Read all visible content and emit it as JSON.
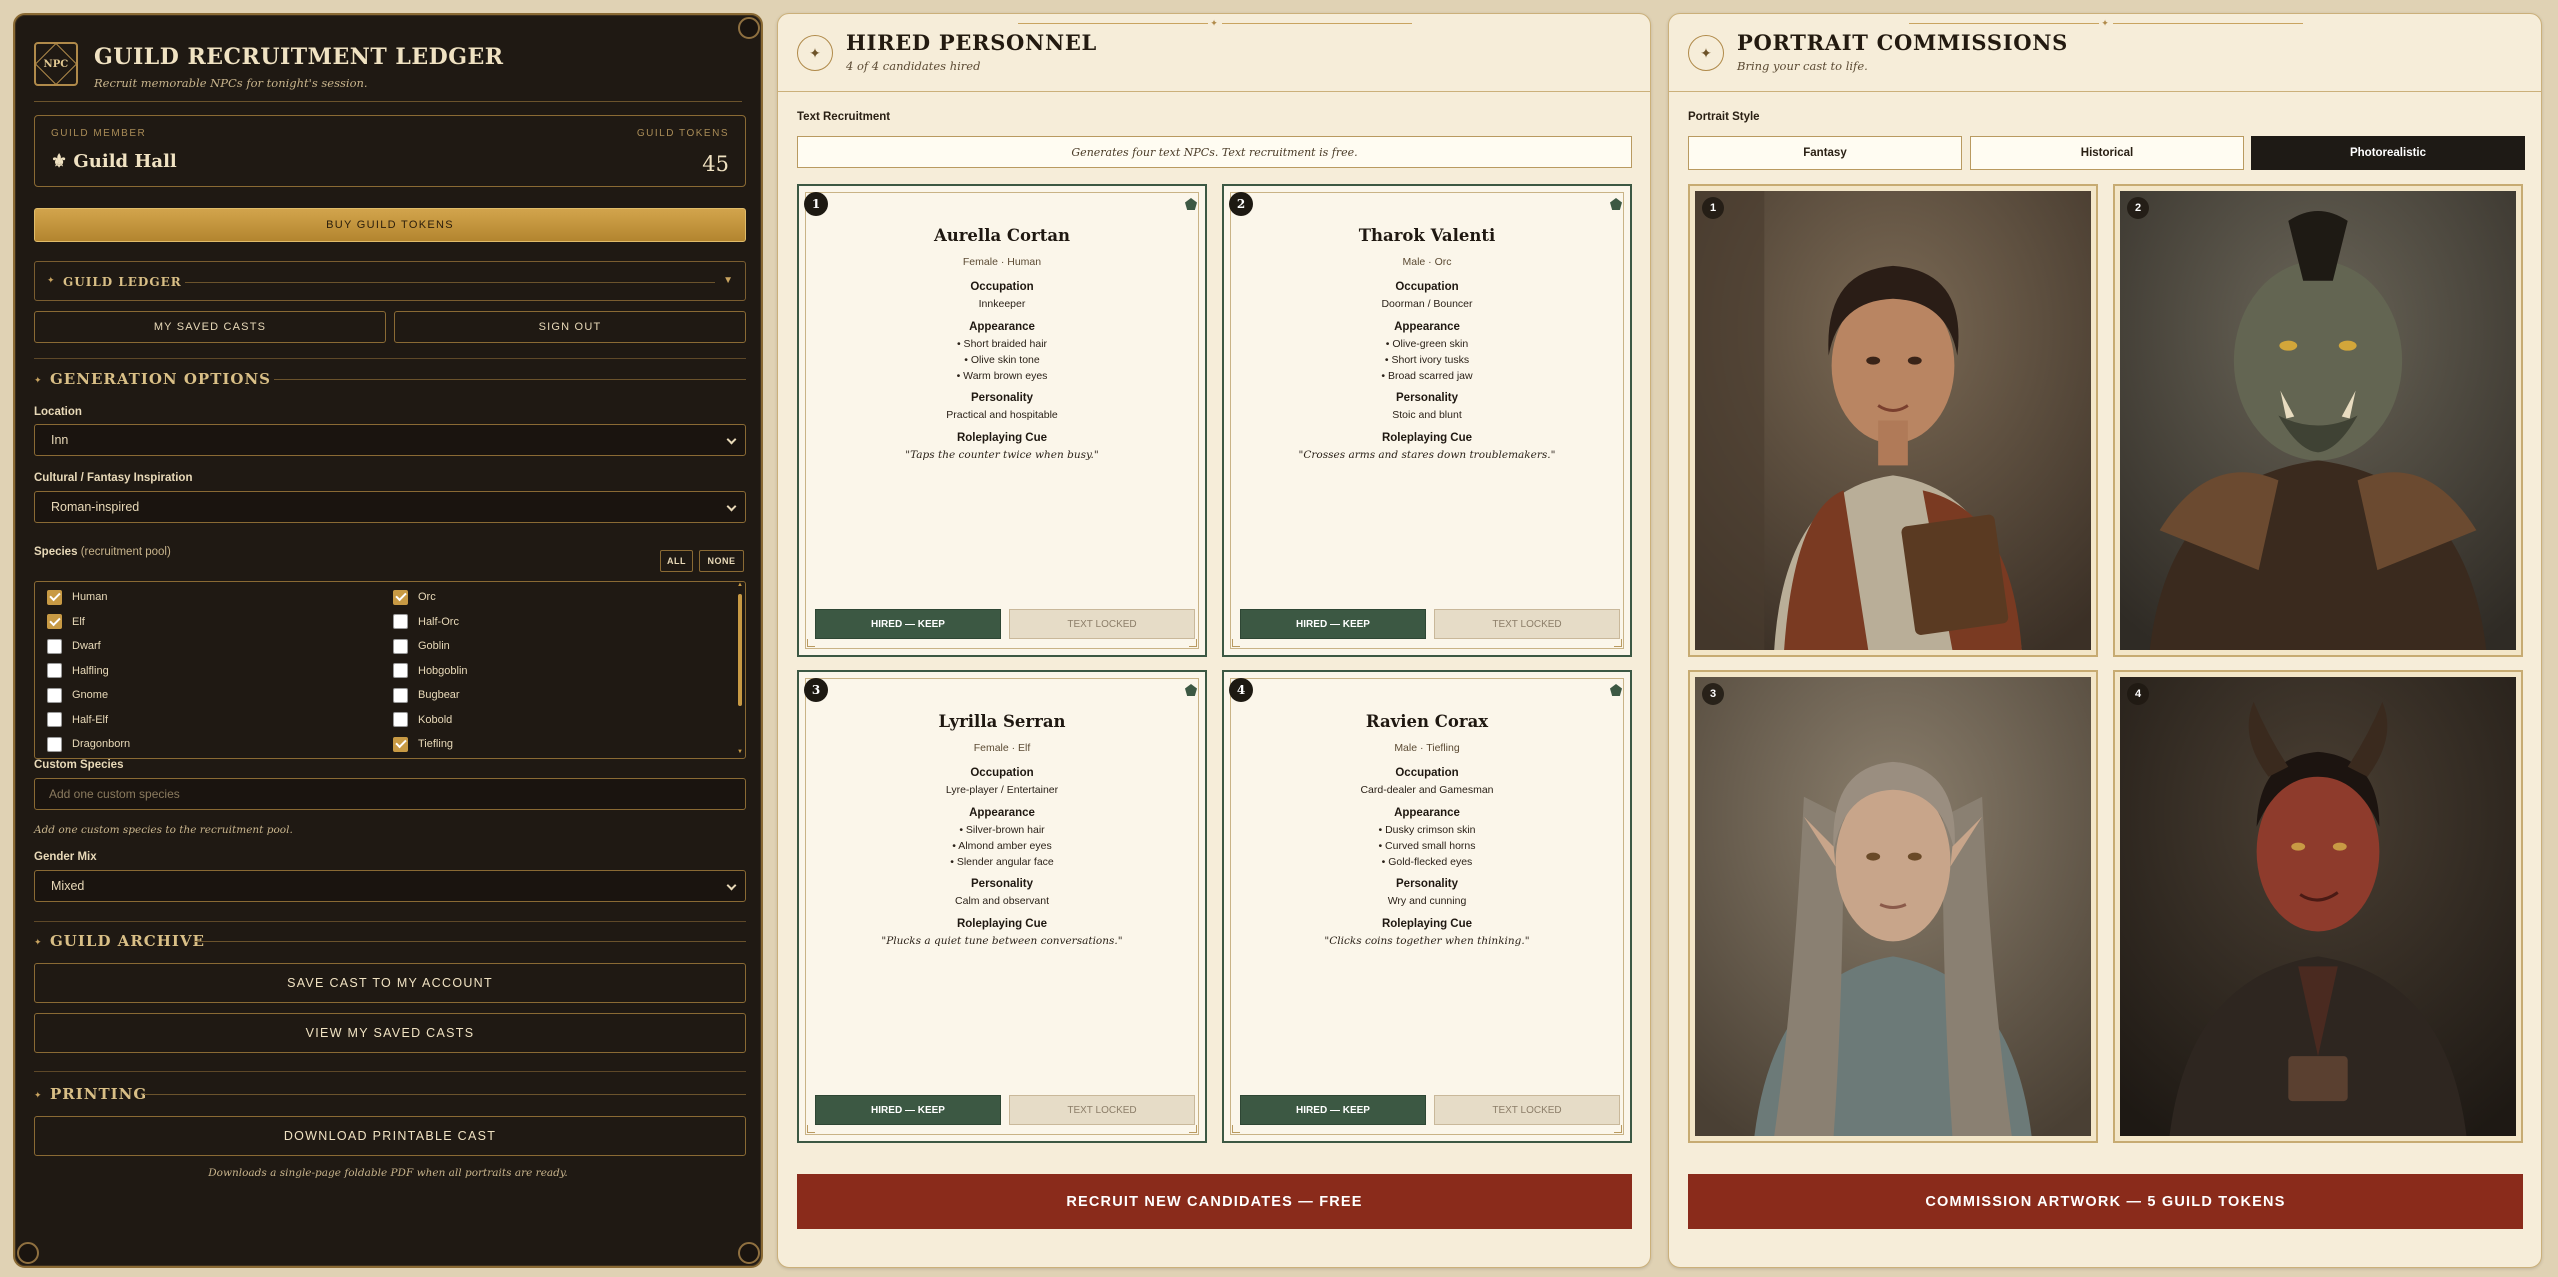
{
  "app": {
    "logo_text": "NPC",
    "title": "GUILD RECRUITMENT LEDGER",
    "subtitle": "Recruit memorable NPCs for tonight's session."
  },
  "member": {
    "label": "GUILD MEMBER",
    "name": "Guild Hall",
    "tokens_label": "GUILD TOKENS",
    "tokens": "45"
  },
  "buy_tokens_label": "BUY GUILD TOKENS",
  "ledger": {
    "label": "GUILD LEDGER",
    "saved_casts_label": "MY SAVED CASTS",
    "sign_out_label": "SIGN OUT"
  },
  "generation": {
    "heading": "GENERATION OPTIONS",
    "location_label": "Location",
    "location_value": "Inn",
    "culture_label": "Cultural / Fantasy Inspiration",
    "culture_value": "Roman-inspired",
    "species_label": "Species",
    "species_sub": "(recruitment pool)",
    "all_label": "ALL",
    "none_label": "NONE",
    "species_left": [
      {
        "name": "Human",
        "checked": true
      },
      {
        "name": "Elf",
        "checked": true
      },
      {
        "name": "Dwarf",
        "checked": false
      },
      {
        "name": "Halfling",
        "checked": false
      },
      {
        "name": "Gnome",
        "checked": false
      },
      {
        "name": "Half-Elf",
        "checked": false
      },
      {
        "name": "Dragonborn",
        "checked": false
      }
    ],
    "species_right": [
      {
        "name": "Orc",
        "checked": true
      },
      {
        "name": "Half-Orc",
        "checked": false
      },
      {
        "name": "Goblin",
        "checked": false
      },
      {
        "name": "Hobgoblin",
        "checked": false
      },
      {
        "name": "Bugbear",
        "checked": false
      },
      {
        "name": "Kobold",
        "checked": false
      },
      {
        "name": "Tiefling",
        "checked": true
      }
    ],
    "custom_label": "Custom Species",
    "custom_placeholder": "Add one custom species",
    "custom_hint": "Add one custom species to the recruitment pool.",
    "gender_label": "Gender Mix",
    "gender_value": "Mixed"
  },
  "archive": {
    "heading": "GUILD ARCHIVE",
    "save_label": "SAVE CAST TO MY ACCOUNT",
    "view_label": "VIEW MY SAVED CASTS"
  },
  "printing": {
    "heading": "PRINTING",
    "download_label": "DOWNLOAD PRINTABLE CAST",
    "hint": "Downloads a single-page foldable PDF when all portraits are ready."
  },
  "hired": {
    "title": "HIRED PERSONNEL",
    "subtitle": "4 of 4 candidates hired",
    "section_label": "Text Recruitment",
    "note": "Generates four text NPCs. Text recruitment is free.",
    "field_labels": {
      "occupation": "Occupation",
      "appearance": "Appearance",
      "personality": "Personality",
      "cue": "Roleplaying Cue"
    },
    "keep_label": "HIRED — KEEP",
    "locked_label": "TEXT LOCKED",
    "recruit_label": "RECRUIT NEW CANDIDATES — FREE",
    "npcs": [
      {
        "num": "1",
        "name": "Aurella Cortan",
        "meta": "Female · Human",
        "occupation": "Innkeeper",
        "appearance": [
          "• Short braided hair",
          "• Olive skin tone",
          "• Warm brown eyes"
        ],
        "personality": "Practical and hospitable",
        "cue": "\"Taps the counter twice when busy.\""
      },
      {
        "num": "2",
        "name": "Tharok Valenti",
        "meta": "Male · Orc",
        "occupation": "Doorman / Bouncer",
        "appearance": [
          "• Olive-green skin",
          "• Short ivory tusks",
          "• Broad scarred jaw"
        ],
        "personality": "Stoic and blunt",
        "cue": "\"Crosses arms and stares down troublemakers.\""
      },
      {
        "num": "3",
        "name": "Lyrilla Serran",
        "meta": "Female · Elf",
        "occupation": "Lyre-player / Entertainer",
        "appearance": [
          "• Silver-brown hair",
          "• Almond amber eyes",
          "• Slender angular face"
        ],
        "personality": "Calm and observant",
        "cue": "\"Plucks a quiet tune between conversations.\""
      },
      {
        "num": "4",
        "name": "Ravien Corax",
        "meta": "Male · Tiefling",
        "occupation": "Card-dealer and Gamesman",
        "appearance": [
          "• Dusky crimson skin",
          "• Curved small horns",
          "• Gold-flecked eyes"
        ],
        "personality": "Wry and cunning",
        "cue": "\"Clicks coins together when thinking.\""
      }
    ]
  },
  "portraits": {
    "title": "PORTRAIT COMMISSIONS",
    "subtitle": "Bring your cast to life.",
    "style_label": "Portrait Style",
    "styles": [
      "Fantasy",
      "Historical",
      "Photorealistic"
    ],
    "active_style": "Photorealistic",
    "nums": [
      "1",
      "2",
      "3",
      "4"
    ],
    "commission_label": "COMMISSION ARTWORK — 5 GUILD TOKENS"
  },
  "colors": {
    "accent_gold": "#c89a44",
    "hire_green": "#3c5843",
    "action_red": "#8a2b1b",
    "dark_panel": "#1f1913"
  }
}
